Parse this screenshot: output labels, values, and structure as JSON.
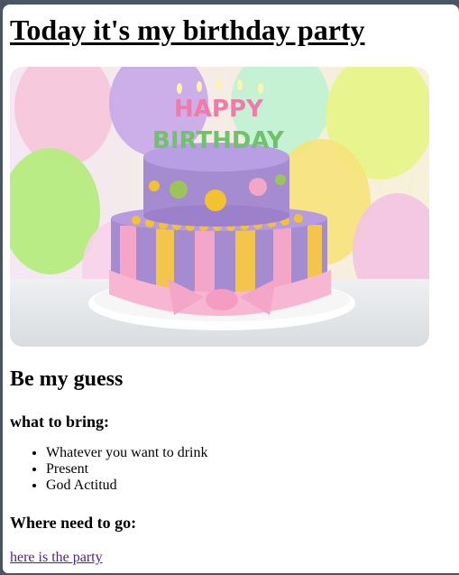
{
  "page": {
    "title": "Today it's my birthday party",
    "image": {
      "kind": "birthday cake photo",
      "topper_line1": "HAPPY",
      "topper_line2": "BIRTHDAY"
    },
    "section_heading": "Be my guess",
    "bring_heading": "what to bring:",
    "bring_items": [
      "Whatever you want to drink",
      "Present",
      "God Actitud"
    ],
    "where_heading": "Where need to go:",
    "party_link": "here is the party"
  },
  "colors": {
    "background": "#4a5563",
    "link_visited": "#551a8b",
    "cake_purple": "#a58bd0",
    "cake_pink": "#f4a6c9"
  }
}
